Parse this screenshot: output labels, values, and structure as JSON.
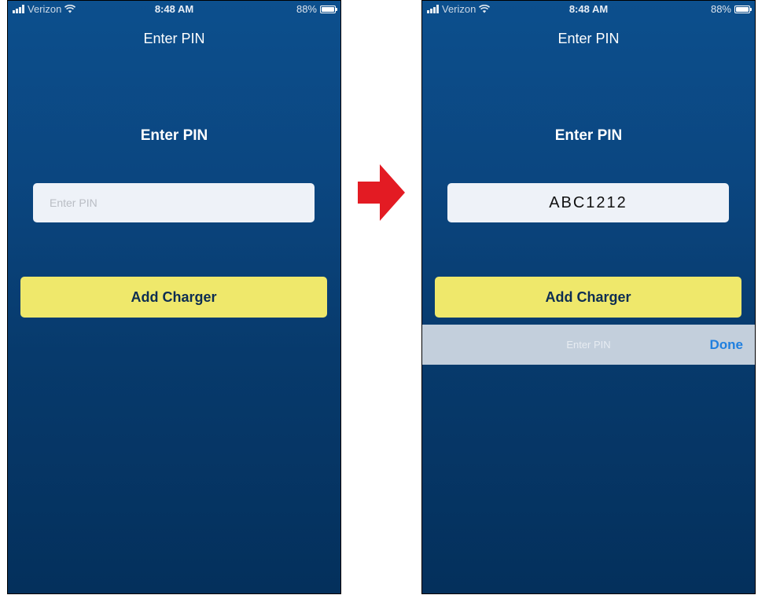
{
  "status_bar": {
    "carrier": "Verizon",
    "time": "8:48 AM",
    "battery": "88%"
  },
  "screen_before": {
    "nav_title": "Enter PIN",
    "heading": "Enter PIN",
    "pin_placeholder": "Enter PIN",
    "button_label": "Add Charger"
  },
  "screen_after": {
    "nav_title": "Enter PIN",
    "heading": "Enter PIN",
    "pin_value": "ABC1212",
    "button_label": "Add Charger",
    "accessory_label": "Enter PIN",
    "done_label": "Done"
  },
  "colors": {
    "background_top": "#0c4f8d",
    "background_bottom": "#04305c",
    "button_yellow": "#efe86b",
    "done_blue": "#1f7fdf",
    "arrow_red": "#e31b23"
  }
}
